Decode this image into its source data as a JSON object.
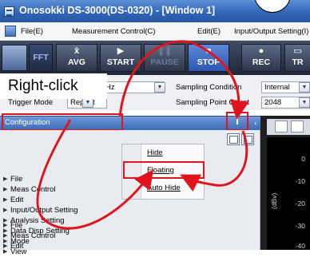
{
  "window": {
    "title": "Onosokki DS-3000(DS-0320) - [Window 1]"
  },
  "menu": {
    "items": [
      {
        "label": "File(E)"
      },
      {
        "label": "Measurement Control(C)"
      },
      {
        "label": "Edit(E)"
      },
      {
        "label": "Input/Output Setting(I)"
      }
    ]
  },
  "toolbar": {
    "fft_label": "FFT",
    "avg": {
      "glyph": "x̄",
      "label": "AVG"
    },
    "start": {
      "glyph": "▶",
      "label": "START"
    },
    "pause": {
      "glyph": "❚❚",
      "label": "PAUSE"
    },
    "stop": {
      "glyph": "■",
      "label": "STOP"
    },
    "rec": {
      "glyph": "●",
      "label": "REC"
    },
    "tr": {
      "glyph": "▭",
      "label": "TR"
    }
  },
  "conditions": {
    "freq_combo_value": "Hz",
    "trigger_mode_label": "Trigger Mode",
    "trigger_mode_value": "Repeat",
    "sampling_condition_label": "Sampling Condition",
    "sampling_condition_value": "Internal",
    "sampling_point_count_label": "Sampling Point Count",
    "sampling_point_count_value": "2048"
  },
  "annotation": {
    "right_click": "Right-click"
  },
  "configuration_panel": {
    "title": "Configuration",
    "pin_glyph": "ꟾ",
    "close_glyph": "‹",
    "tree": [
      {
        "label": "File"
      },
      {
        "label": "Meas Control"
      },
      {
        "label": "Edit"
      },
      {
        "label": "Input/Output Setting"
      },
      {
        "label": "Analysis Setting"
      },
      {
        "label": "Data Disp Setting"
      },
      {
        "label": "Mode"
      },
      {
        "label": "View"
      }
    ]
  },
  "context_menu": {
    "items": [
      {
        "label": "Hide"
      },
      {
        "label": "Floating"
      },
      {
        "label": "Auto Hide"
      }
    ]
  },
  "graph": {
    "y_ticks": [
      "0",
      "-10",
      "-20",
      "-30",
      "-40"
    ],
    "y_label": "(dBv)"
  },
  "colors": {
    "highlight_red": "#e0141c",
    "title_blue": "#2f63b6",
    "toolbar_dark": "#1f2838"
  }
}
